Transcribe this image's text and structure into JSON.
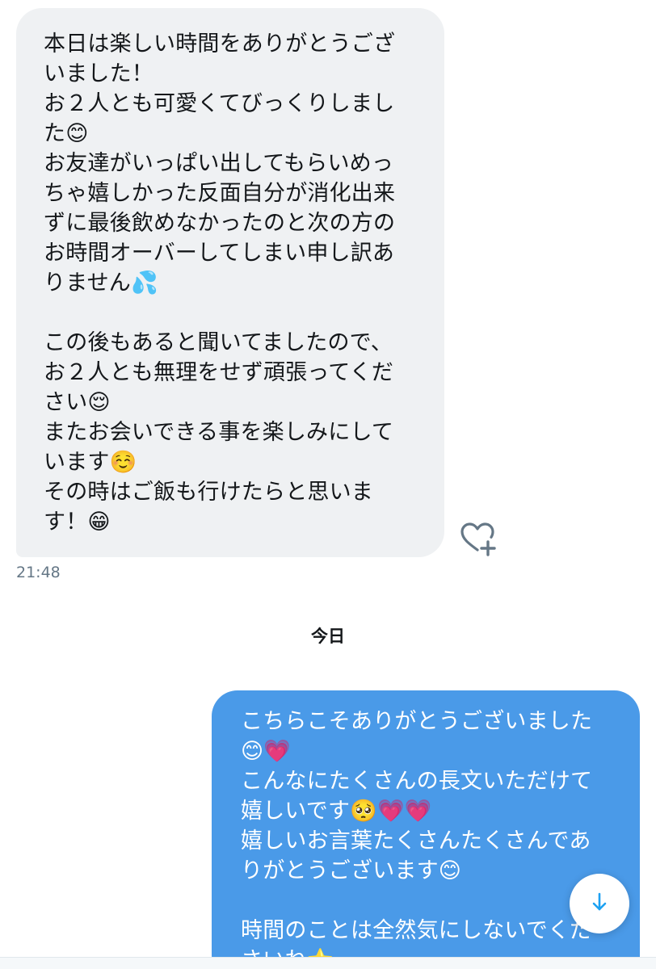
{
  "conversation": {
    "incoming_message": {
      "lines": [
        "本日は楽しい時間をありがとうござ",
        "いました！",
        "お２人とも可愛くてびっくりしまし",
        "た😊",
        "お友達がいっぱい出してもらいめっ",
        "ちゃ嬉しかった反面自分が消化出来",
        "ずに最後飲めなかったのと次の方の",
        "お時間オーバーしてしまい申し訳あ",
        "りません💦",
        "",
        "この後もあると聞いてましたので、",
        "お２人とも無理をせず頑張ってくだ",
        "さい😌",
        "またお会いできる事を楽しみにして",
        "います☺️",
        "その時はご飯も行けたらと思いま",
        "す！😁"
      ],
      "timestamp": "21:48"
    },
    "day_separator": "今日",
    "outgoing_message": {
      "lines": [
        "こちらこそありがとうございました",
        "😊💗",
        "こんなにたくさんの長文いただけて",
        "嬉しいです🥺💗💗",
        "嬉しいお言葉たくさんたくさんであ",
        "りがとうございます😊",
        "",
        "時間のことは全然気にしないでくだ",
        "さいね⭐"
      ]
    }
  },
  "icons": {
    "like": "heart-plus-icon",
    "scroll_down": "arrow-down-icon"
  },
  "colors": {
    "incoming_bubble": "#eff1f3",
    "outgoing_bubble": "#4a9ae8",
    "muted_text": "#657786",
    "accent": "#1da1f2"
  }
}
